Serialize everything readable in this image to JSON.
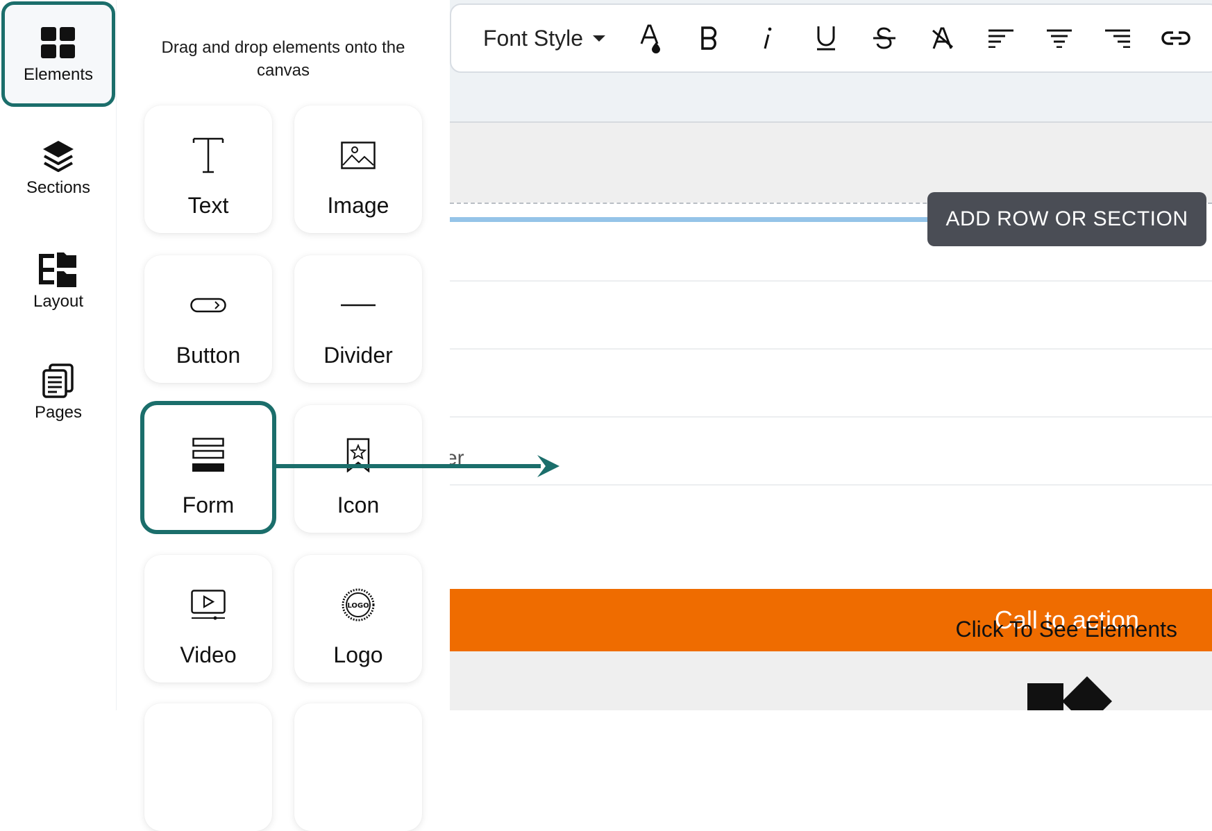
{
  "rail": {
    "items": [
      {
        "label": "Elements",
        "icon": "grid-icon",
        "active": true
      },
      {
        "label": "Sections",
        "icon": "layers-icon"
      },
      {
        "label": "Layout",
        "icon": "tree-folders-icon"
      },
      {
        "label": "Pages",
        "icon": "pages-icon"
      }
    ]
  },
  "panel": {
    "hint": "Drag and drop elements onto the canvas",
    "tiles": [
      {
        "label": "Text",
        "icon": "text-icon"
      },
      {
        "label": "Image",
        "icon": "image-icon"
      },
      {
        "label": "Button",
        "icon": "button-icon"
      },
      {
        "label": "Divider",
        "icon": "divider-icon"
      },
      {
        "label": "Form",
        "icon": "form-icon",
        "selected": true
      },
      {
        "label": "Icon",
        "icon": "bookmark-star-icon"
      },
      {
        "label": "Video",
        "icon": "video-icon"
      },
      {
        "label": "Logo",
        "icon": "logo-badge-icon",
        "badge_text": "LOGO"
      }
    ]
  },
  "toolbar": {
    "font_style_label": "Font Style",
    "buttons": [
      "text-color-icon",
      "bold-icon",
      "italic-icon",
      "underline-icon",
      "strikethrough-icon",
      "clear-format-icon",
      "align-left-icon",
      "align-center-icon",
      "align-right-icon",
      "link-icon"
    ]
  },
  "canvas": {
    "add_row_label": "ADD ROW OR SECTION",
    "partial_text": "er",
    "cta_label": "Call to action",
    "click_hint": "Click To See Elements"
  },
  "colors": {
    "accent": "#1b6e6b",
    "cta": "#ef6c00",
    "add_row_bg": "#4a4d55",
    "drop_line": "#95c4e8"
  }
}
